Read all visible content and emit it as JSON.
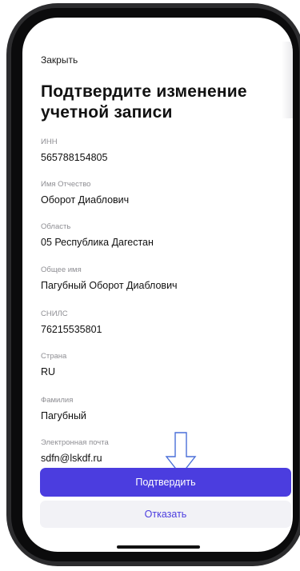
{
  "header": {
    "close_label": "Закрыть",
    "title": "Подтвердите изменение учетной записи"
  },
  "fields": [
    {
      "label": "ИНН",
      "value": "565788154805"
    },
    {
      "label": "Имя Отчество",
      "value": "Оборот Диаблович"
    },
    {
      "label": "Область",
      "value": "05 Республика Дагестан"
    },
    {
      "label": "Общее имя",
      "value": "Пагубный Оборот Диаблович"
    },
    {
      "label": "СНИЛС",
      "value": "76215535801"
    },
    {
      "label": "Страна",
      "value": "RU"
    },
    {
      "label": "Фамилия",
      "value": "Пагубный"
    },
    {
      "label": "Электронная почта",
      "value": "sdfn@lskdf.ru"
    }
  ],
  "actions": {
    "confirm_label": "Подтвердить",
    "reject_label": "Отказать"
  },
  "icons": {
    "annotation_arrow": "down-arrow-icon"
  },
  "colors": {
    "accent": "#4b3ddf",
    "secondary_button_bg": "#f2f2f6",
    "label_gray": "#8e8e93",
    "frame": "#2c2c2e"
  }
}
